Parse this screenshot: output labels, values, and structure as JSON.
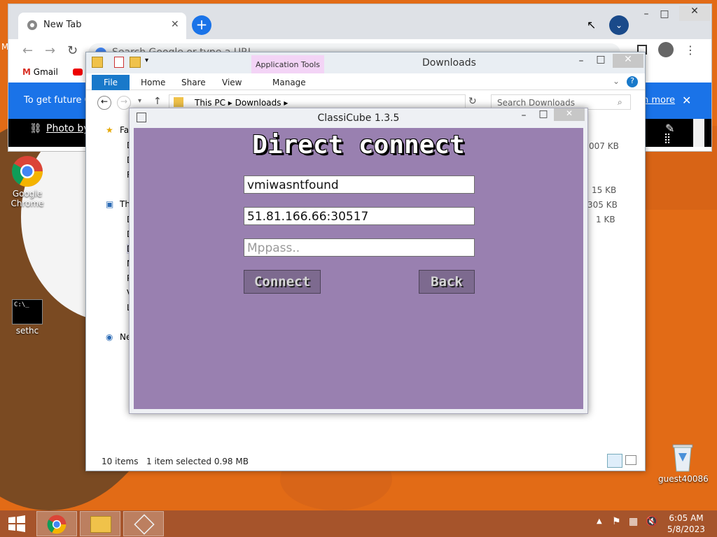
{
  "desktop": {
    "icons": [
      {
        "label": "Google Chrome"
      },
      {
        "label": "sethc"
      },
      {
        "label": "guest40086"
      }
    ],
    "partial_label": "M"
  },
  "chrome": {
    "tab_title": "New Tab",
    "omnibox_placeholder": "Search Google or type a URL",
    "bookmarks": [
      "Gmail"
    ],
    "infobar_text": "To get future Go",
    "infobar_link": "n more",
    "photo_link": "Photo by"
  },
  "explorer": {
    "title": "Downloads",
    "app_tools": "Application Tools",
    "tabs": {
      "file": "File",
      "home": "Home",
      "share": "Share",
      "view": "View",
      "manage": "Manage"
    },
    "breadcrumb": [
      "This PC",
      "Downloads"
    ],
    "search_placeholder": "Search Downloads",
    "nav": {
      "favorites": "Fa",
      "thispc": "Th",
      "network": "Ne",
      "item_letters": [
        "D",
        "D",
        "R",
        "D",
        "D",
        "D",
        "M",
        "P",
        "V",
        "L"
      ]
    },
    "sizes": [
      "007 KB",
      "15 KB",
      "305 KB",
      "1 KB"
    ],
    "status": {
      "items": "10 items",
      "selected": "1 item selected  0.98 MB"
    }
  },
  "classicube": {
    "window_title": "ClassiCube 1.3.5",
    "heading": "Direct connect",
    "username": "vmiwasntfound",
    "address": "51.81.166.66:30517",
    "mppass_placeholder": "Mppass..",
    "connect_label": "Connect",
    "back_label": "Back"
  },
  "taskbar": {
    "time": "6:05 AM",
    "date": "5/8/2023"
  },
  "colors": {
    "wallpaper": "#e26b16",
    "classicube_bg": "#9980b0",
    "chrome_blue": "#1a73e8",
    "file_tab": "#1979ca",
    "taskbar": "#a6542b"
  }
}
